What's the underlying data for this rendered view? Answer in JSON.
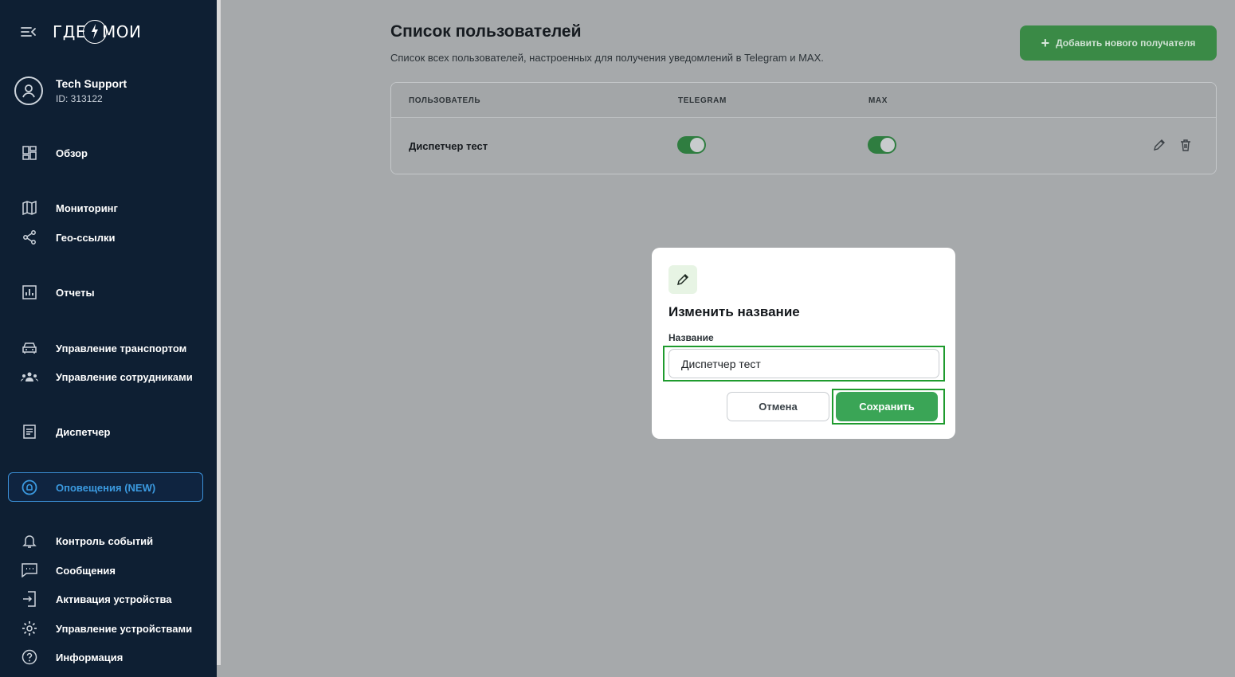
{
  "app": {
    "logo_left": "ГДЕ",
    "logo_right": "МОИ"
  },
  "profile": {
    "name": "Tech Support",
    "id": "ID: 313122"
  },
  "sidebar": {
    "items": [
      {
        "label": "Обзор",
        "icon": "dashboard-icon"
      },
      {
        "label": "Мониторинг",
        "icon": "map-icon"
      },
      {
        "label": "Гео-ссылки",
        "icon": "share-icon"
      },
      {
        "label": "Отчеты",
        "icon": "report-icon"
      },
      {
        "label": "Управление транспортом",
        "icon": "car-icon"
      },
      {
        "label": "Управление сотрудниками",
        "icon": "people-icon"
      },
      {
        "label": "Диспетчер",
        "icon": "dispatcher-icon"
      },
      {
        "label": "Оповещения (NEW)",
        "icon": "alert-at-icon",
        "active": true
      },
      {
        "label": "Контроль событий",
        "icon": "bell-icon"
      },
      {
        "label": "Сообщения",
        "icon": "message-icon"
      },
      {
        "label": "Активация устройства",
        "icon": "login-icon"
      },
      {
        "label": "Управление устройствами",
        "icon": "gear-icon"
      },
      {
        "label": "Информация",
        "icon": "help-icon"
      }
    ]
  },
  "main": {
    "title": "Список пользователей",
    "subtitle": "Список всех пользователей, настроенных для получения уведомлений в Telegram и MAX.",
    "add_button": "Добавить нового получателя",
    "table": {
      "headers": [
        "ПОЛЬЗОВАТЕЛЬ",
        "TELEGRAM",
        "MAX"
      ],
      "rows": [
        {
          "name": "Диспетчер тест",
          "telegram": true,
          "max": true
        }
      ]
    }
  },
  "modal": {
    "title": "Изменить название",
    "field_label": "Название",
    "field_value": "Диспетчер тест",
    "cancel": "Отмена",
    "save": "Сохранить"
  },
  "colors": {
    "sidebar_bg": "#0e1f33",
    "accent_green": "#3aa556",
    "active_blue": "#3b9ae0",
    "highlight": "#1f9b2e"
  }
}
